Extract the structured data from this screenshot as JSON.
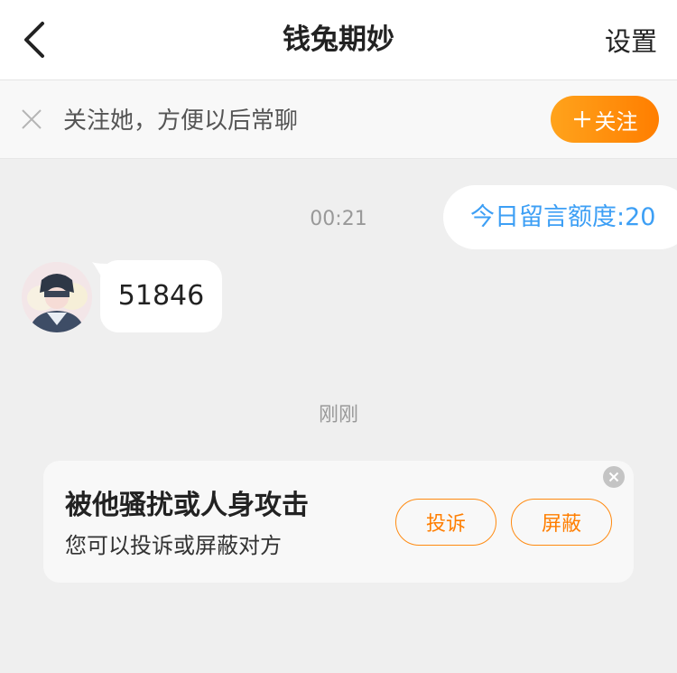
{
  "header": {
    "title": "钱兔期妙",
    "settings_label": "设置",
    "back_icon": "chevron-left-icon"
  },
  "follow_bar": {
    "text": "关注她，方便以后常聊",
    "button_label": "关注",
    "close_icon": "close-icon",
    "plus_icon": "plus-icon"
  },
  "chat": {
    "quota_text": "今日留言额度:20",
    "time_1": "00:21",
    "message_text": "51846",
    "time_2": "刚刚"
  },
  "report_card": {
    "title": "被他骚扰或人身攻击",
    "subtitle": "您可以投诉或屏蔽对方",
    "complain_label": "投诉",
    "block_label": "屏蔽",
    "close_icon": "close-circle-icon"
  },
  "colors": {
    "accent_orange": "#ff8a10",
    "quota_blue": "#3d9ff5",
    "background": "#efefef"
  }
}
